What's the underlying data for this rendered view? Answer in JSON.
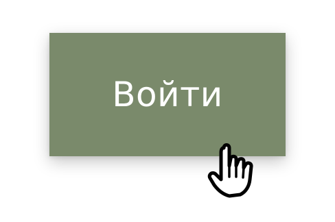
{
  "button": {
    "label": "Войти",
    "background_color": "#7a8a6b",
    "text_color": "#ffffff"
  },
  "cursor": {
    "icon": "hand-pointer-icon"
  }
}
